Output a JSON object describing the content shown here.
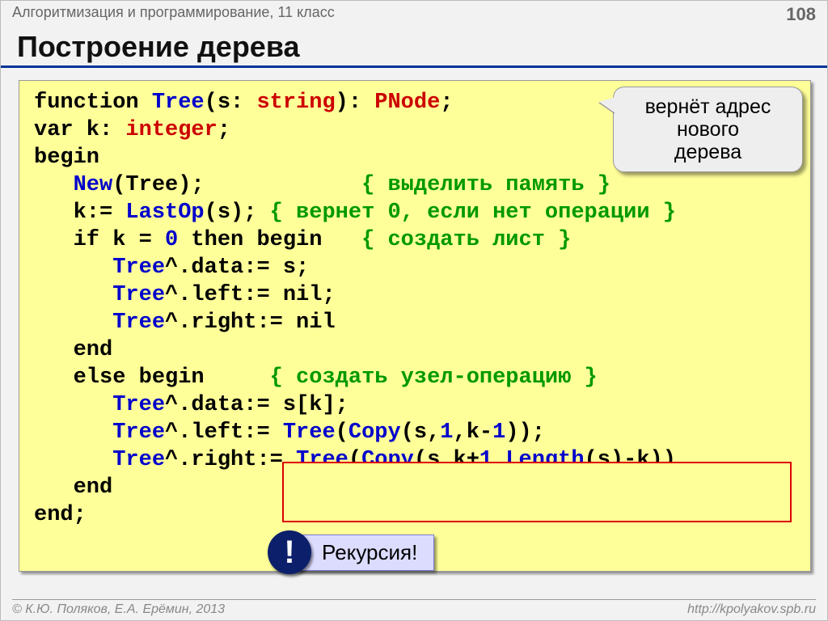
{
  "header": {
    "subject": "Алгоритмизация и программирование, 11 класс",
    "page_number": "108"
  },
  "title": "Построение дерева",
  "callout": {
    "line1": "вернёт адрес",
    "line2": "нового",
    "line3": "дерева"
  },
  "code": {
    "l1": {
      "a": "function ",
      "b": "Tree",
      "c": "(s: ",
      "d": "string",
      "e": "): ",
      "f": "PNode",
      "g": ";"
    },
    "l2": {
      "a": "var k: ",
      "b": "integer",
      "c": ";"
    },
    "l3": {
      "a": "begin"
    },
    "l4": {
      "a": "   ",
      "b": "New",
      "c": "(Tree);            ",
      "d": "{ выделить память }"
    },
    "l5": {
      "a": "   k:= ",
      "b": "LastOp",
      "c": "(s); ",
      "d": "{ вернет 0, если нет операции }"
    },
    "l6": {
      "a": "   if k = ",
      "b": "0",
      "c": " then begin   ",
      "d": "{ создать лист }"
    },
    "l7": {
      "a": "      ",
      "b": "Tree",
      "c": "^.data:= s;"
    },
    "l8": {
      "a": "      ",
      "b": "Tree",
      "c": "^.left:= nil;"
    },
    "l9": {
      "a": "      ",
      "b": "Tree",
      "c": "^.right:= nil"
    },
    "l10": {
      "a": "   end"
    },
    "l11": {
      "a": "   else begin     ",
      "b": "{ создать узел-операцию }"
    },
    "l12": {
      "a": "      ",
      "b": "Tree",
      "c": "^.data:= s[k];"
    },
    "l13": {
      "a": "      ",
      "b": "Tree",
      "c": "^.left:= ",
      "d": "Tree",
      "e": "(",
      "f": "Copy",
      "g": "(s,",
      "h": "1",
      "i": ",k-",
      "j": "1",
      "k": "));"
    },
    "l14": {
      "a": "      ",
      "b": "Tree",
      "c": "^.right:= ",
      "d": "Tree",
      "e": "(",
      "f": "Copy",
      "g": "(s,k+",
      "h": "1",
      "i": ",",
      "j": "Length",
      "k": "(s)-k))"
    },
    "l15": {
      "a": "   end"
    },
    "l16": {
      "a": "end;"
    }
  },
  "badge": {
    "mark": "!",
    "label": "Рекурсия!"
  },
  "footer": {
    "left": "© К.Ю. Поляков, Е.А. Ерёмин, 2013",
    "right": "http://kpolyakov.spb.ru"
  }
}
